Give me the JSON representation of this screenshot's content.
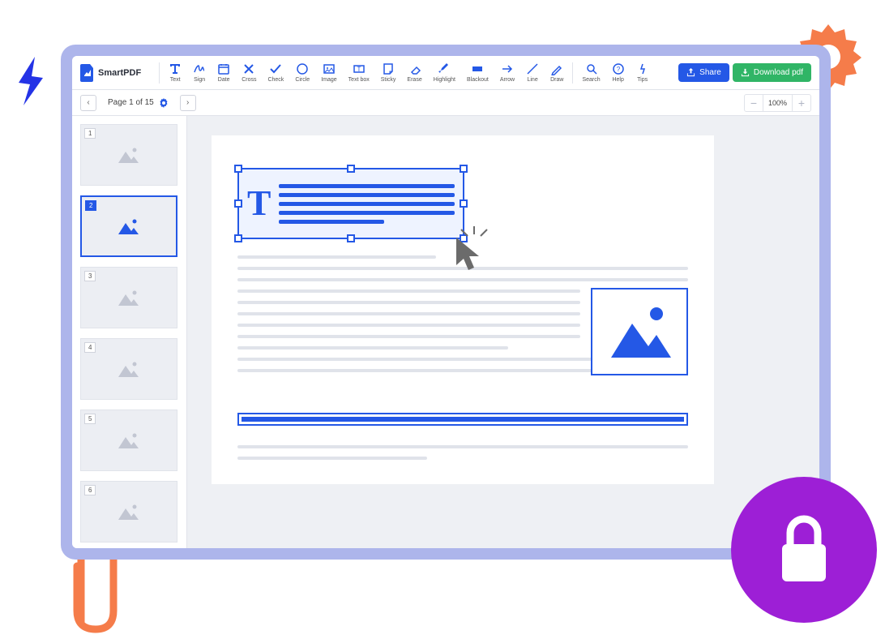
{
  "app": {
    "name": "SmartPDF"
  },
  "toolbar": {
    "tools": [
      {
        "label": "Text",
        "icon": "text"
      },
      {
        "label": "Sign",
        "icon": "sign"
      },
      {
        "label": "Date",
        "icon": "date"
      },
      {
        "label": "Cross",
        "icon": "cross"
      },
      {
        "label": "Check",
        "icon": "check"
      },
      {
        "label": "Circle",
        "icon": "circle"
      },
      {
        "label": "Image",
        "icon": "image"
      },
      {
        "label": "Text box",
        "icon": "textbox"
      },
      {
        "label": "Sticky",
        "icon": "sticky"
      },
      {
        "label": "Erase",
        "icon": "erase"
      },
      {
        "label": "Highlight",
        "icon": "highlight"
      },
      {
        "label": "Blackout",
        "icon": "blackout"
      },
      {
        "label": "Arrow",
        "icon": "arrow"
      },
      {
        "label": "Line",
        "icon": "line"
      },
      {
        "label": "Draw",
        "icon": "draw"
      }
    ],
    "utility": [
      {
        "label": "Search",
        "icon": "search"
      },
      {
        "label": "Help",
        "icon": "help"
      },
      {
        "label": "Tips",
        "icon": "tips"
      }
    ],
    "share_label": "Share",
    "download_label": "Download pdf"
  },
  "subbar": {
    "page_label": "Page 1 of 15",
    "zoom": "100%"
  },
  "thumbnails": {
    "count": 6,
    "active": 2
  },
  "colors": {
    "accent": "#2458e6",
    "success": "#30b566",
    "lock_bg": "#9d1fd6",
    "deco_orange": "#f57c4a"
  }
}
